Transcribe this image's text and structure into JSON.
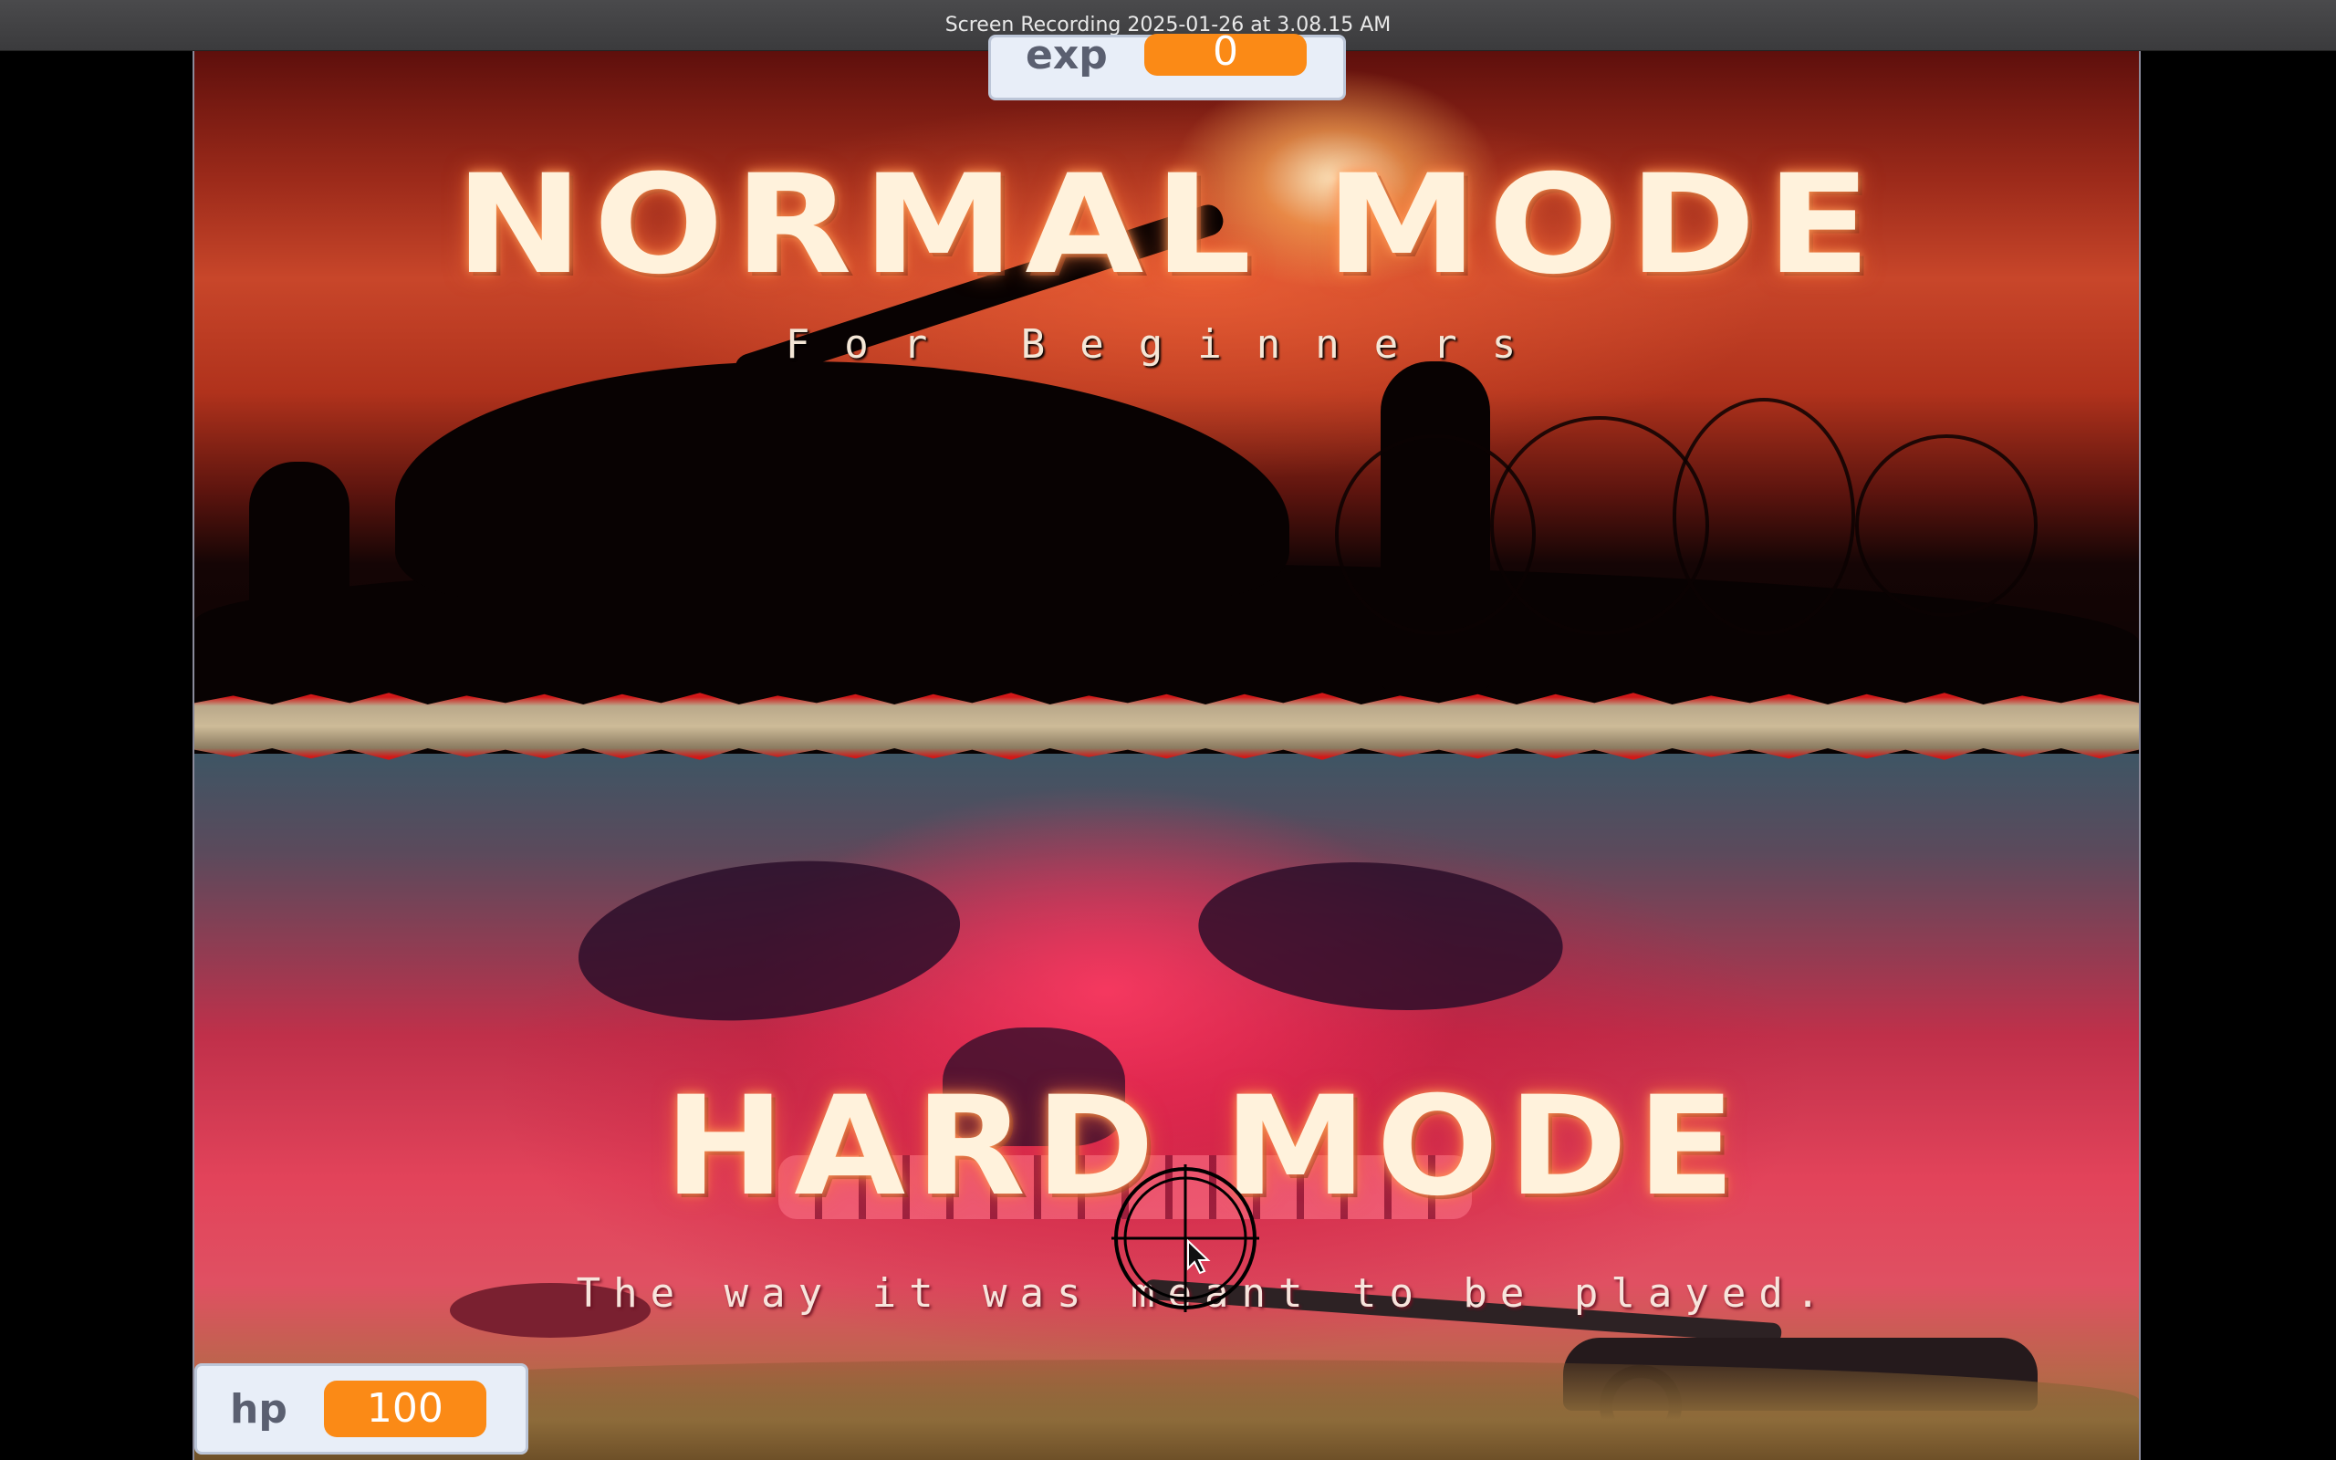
{
  "window": {
    "title": "Screen Recording 2025-01-26 at 3.08.15 AM"
  },
  "hud": {
    "exp": {
      "label": "exp",
      "value": "0"
    },
    "hp": {
      "label": "hp",
      "value": "100"
    }
  },
  "modes": {
    "normal": {
      "title": "NORMAL MODE",
      "subtitle": "For Beginners"
    },
    "hard": {
      "title": "HARD MODE",
      "subtitle": "The way it was meant to be played."
    }
  },
  "icons": {
    "cursor": "crosshair-icon"
  }
}
